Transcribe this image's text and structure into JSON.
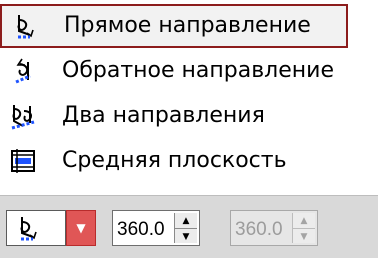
{
  "menu": {
    "items": [
      {
        "label": "Прямое направление",
        "icon": "forward-direction-icon",
        "selected": true
      },
      {
        "label": "Обратное направление",
        "icon": "reverse-direction-icon",
        "selected": false
      },
      {
        "label": "Два направления",
        "icon": "two-directions-icon",
        "selected": false
      },
      {
        "label": "Средняя плоскость",
        "icon": "middle-plane-icon",
        "selected": false
      }
    ]
  },
  "toolbar": {
    "direction_icon": "forward-direction-icon",
    "dropdown_icon": "chevron-down-icon",
    "distance1": "360.0",
    "distance2": "360.0"
  },
  "colors": {
    "selection_border": "#8c1c1c",
    "dropdown_bg": "#e05656",
    "toolbar_bg": "#d9d9d9"
  }
}
